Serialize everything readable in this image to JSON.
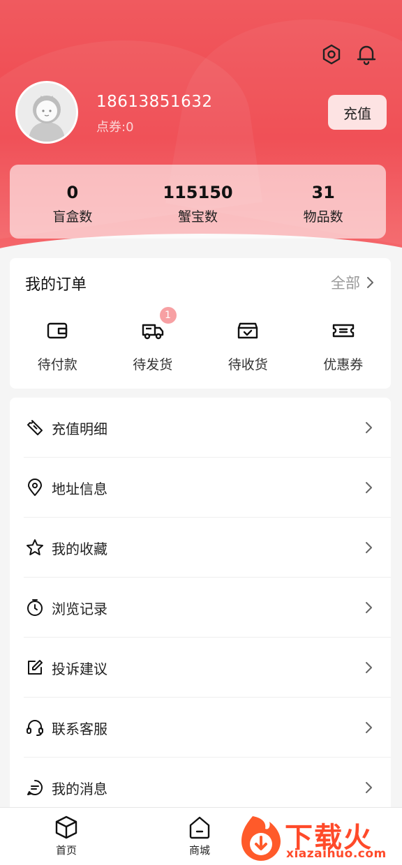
{
  "profile": {
    "phone": "18613851632",
    "points": "点券:0",
    "recharge_label": "充值"
  },
  "stats": [
    {
      "value": "0",
      "label": "盲盒数"
    },
    {
      "value": "115150",
      "label": "蟹宝数"
    },
    {
      "value": "31",
      "label": "物品数"
    }
  ],
  "orders": {
    "title": "我的订单",
    "all_label": "全部",
    "items": [
      {
        "label": "待付款",
        "icon": "wallet-icon"
      },
      {
        "label": "待发货",
        "icon": "truck-icon",
        "badge": "1"
      },
      {
        "label": "待收货",
        "icon": "box-check-icon"
      },
      {
        "label": "优惠券",
        "icon": "ticket-icon"
      }
    ]
  },
  "menu": [
    {
      "label": "充值明细",
      "icon": "ticket-icon"
    },
    {
      "label": "地址信息",
      "icon": "location-pin-icon"
    },
    {
      "label": "我的收藏",
      "icon": "star-icon"
    },
    {
      "label": "浏览记录",
      "icon": "clock-icon"
    },
    {
      "label": "投诉建议",
      "icon": "edit-icon"
    },
    {
      "label": "联系客服",
      "icon": "headset-icon"
    },
    {
      "label": "我的消息",
      "icon": "message-icon"
    }
  ],
  "tabbar": [
    {
      "label": "首页",
      "icon": "cube-icon"
    },
    {
      "label": "商城",
      "icon": "home-icon"
    }
  ],
  "watermark": {
    "title": "下载火",
    "subtitle": "xiazaihuo.com"
  },
  "colors": {
    "primary_red": "#f0474e",
    "badge": "#f7a0a3",
    "watermark": "#ff4a2a"
  }
}
